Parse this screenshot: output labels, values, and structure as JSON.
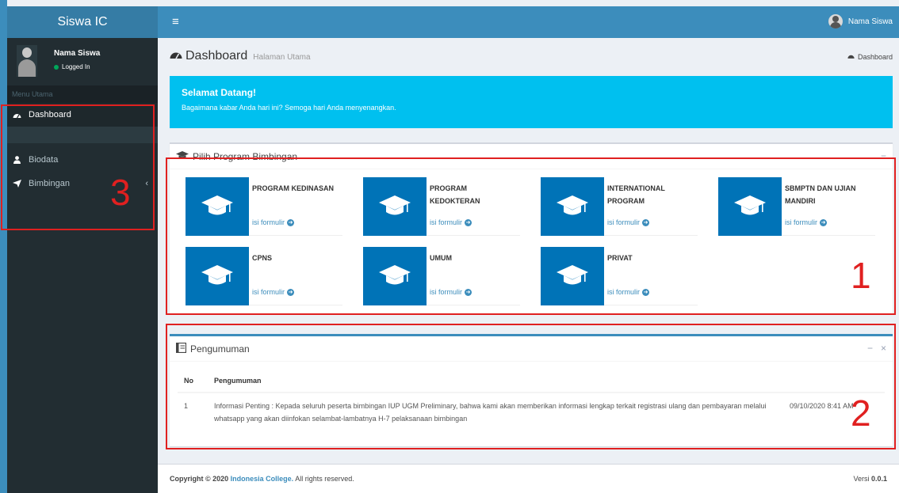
{
  "app": {
    "logo": "Siswa IC"
  },
  "navbar": {
    "hamburger": "≡",
    "user_name": "Nama Siswa"
  },
  "sidebar": {
    "user_name": "Nama Siswa",
    "status": "Logged In",
    "menu_header": "Menu Utama",
    "items": [
      {
        "label": "Dashboard",
        "icon": "dashboard-icon"
      },
      {
        "label": "Biodata",
        "icon": "user-icon"
      },
      {
        "label": "Bimbingan",
        "icon": "send-icon",
        "chevron": "‹"
      }
    ]
  },
  "content_header": {
    "title": "Dashboard",
    "subtitle": "Halaman Utama",
    "breadcrumb": "Dashboard"
  },
  "callout": {
    "title": "Selamat Datang!",
    "text": "Bagaimana kabar Anda hari ini? Semoga hari Anda menyenangkan."
  },
  "programs": {
    "title": "Pilih Program Bimbingan",
    "collapse": "−",
    "link_label": "isi formulir",
    "items": [
      {
        "label": "PROGRAM KEDINASAN"
      },
      {
        "label": "PROGRAM KEDOKTERAN"
      },
      {
        "label": "INTERNATIONAL PROGRAM"
      },
      {
        "label": "SBMPTN DAN UJIAN MANDIRI"
      },
      {
        "label": "CPNS"
      },
      {
        "label": "UMUM"
      },
      {
        "label": "PRIVAT"
      }
    ]
  },
  "announcements": {
    "title": "Pengumuman",
    "collapse": "−",
    "close": "×",
    "columns": [
      "No",
      "Pengumuman",
      ""
    ],
    "rows": [
      {
        "no": "1",
        "text": "Informasi Penting : Kepada seluruh peserta bimbingan IUP UGM Preliminary, bahwa kami akan memberikan informasi lengkap terkait registrasi ulang dan pembayaran melalui whatsapp yang akan diinfokan selambat-lambatnya H-7 pelaksanaan bimbingan",
        "date": "09/10/2020 8:41 AM"
      }
    ]
  },
  "footer": {
    "copyright_prefix": "Copyright © 2020",
    "brand": "Indonesia College.",
    "copyright_suffix": "All rights reserved.",
    "version_label": "Versi",
    "version": "0.0.1"
  },
  "annotations": [
    "1",
    "2",
    "3"
  ],
  "colors": {
    "primary": "#3c8dbc",
    "sidebar": "#222d32",
    "callout": "#00c0ef",
    "tile": "#0073b7",
    "annotation": "#e02020"
  }
}
